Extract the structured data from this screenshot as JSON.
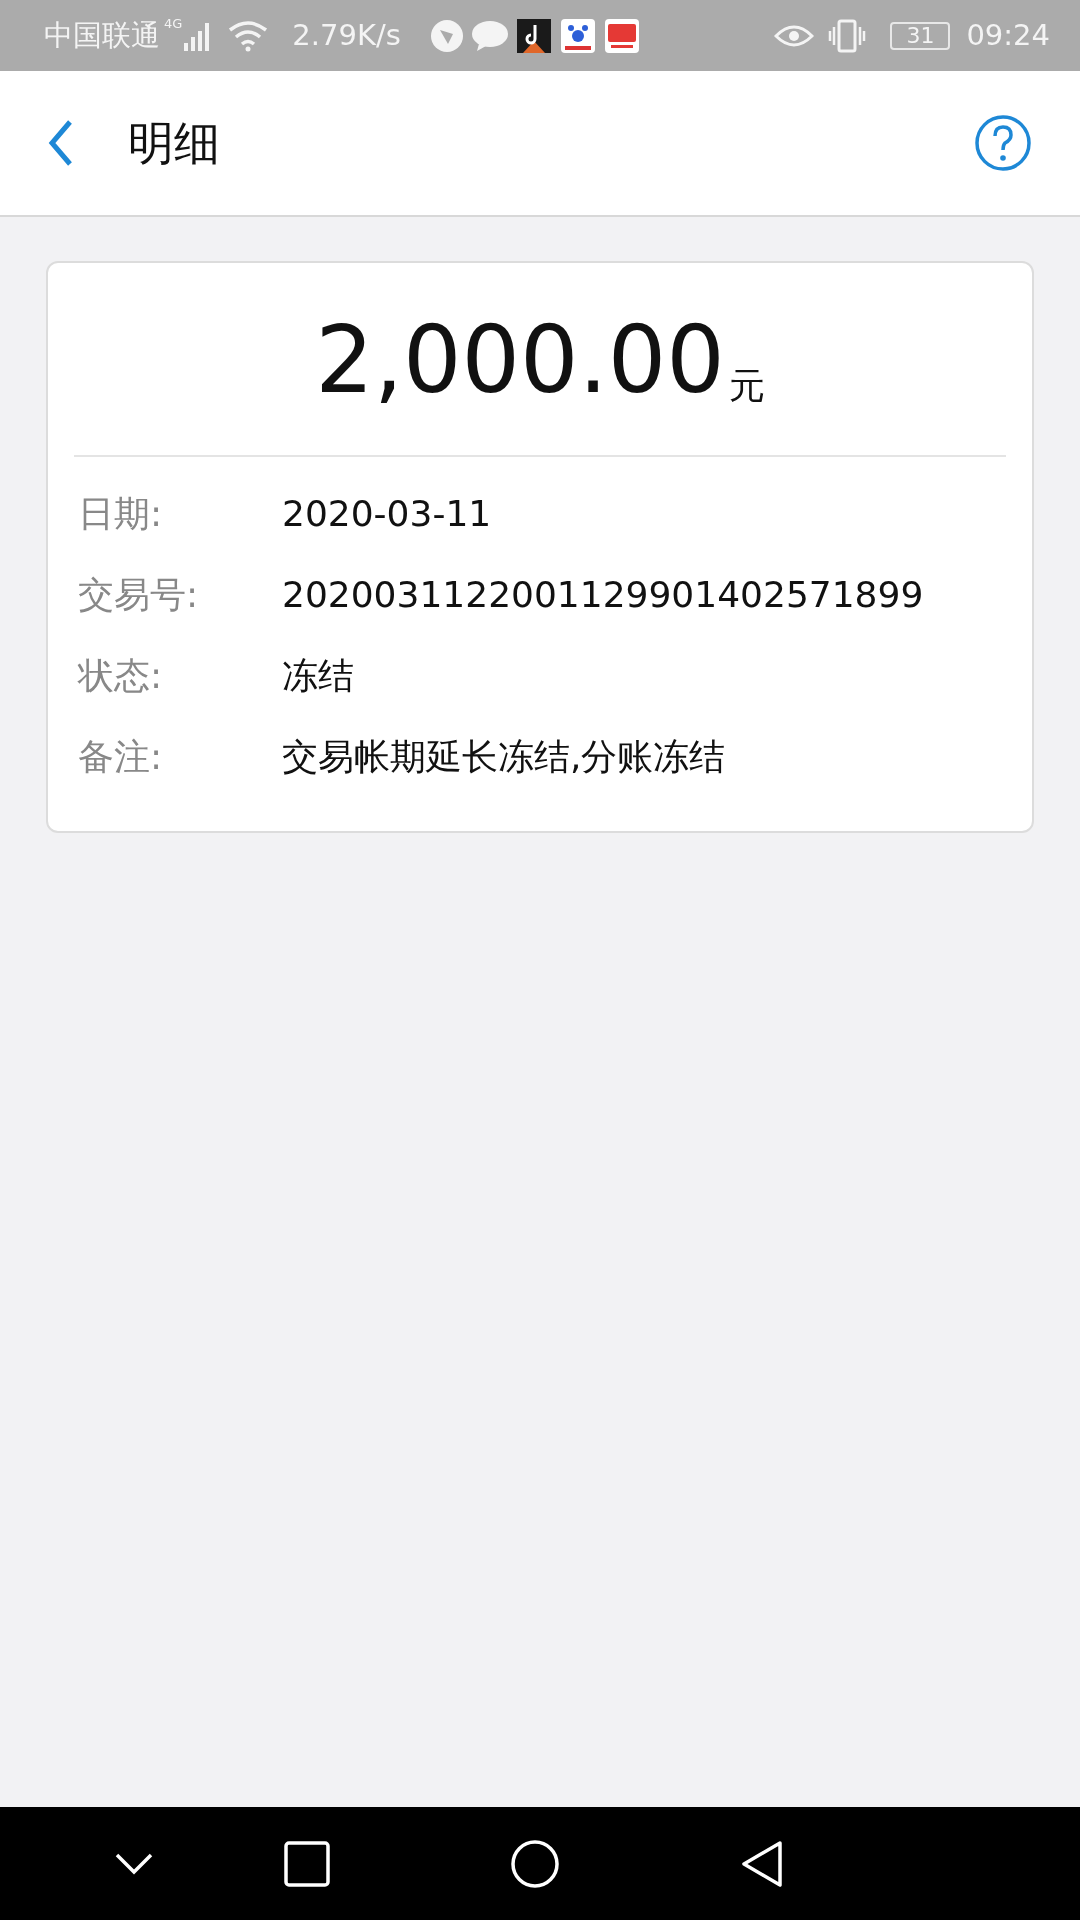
{
  "status_bar": {
    "carrier": "中国联通",
    "network": "4G",
    "speed": "2.79K/s",
    "battery": "31",
    "time": "09:24"
  },
  "header": {
    "title": "明细"
  },
  "detail": {
    "amount": "2,000.00",
    "currency": "元",
    "rows": [
      {
        "label": "日期:",
        "value": "2020-03-11"
      },
      {
        "label": "交易号:",
        "value": "2020031122001129901402571899"
      },
      {
        "label": "状态:",
        "value": "冻结"
      },
      {
        "label": "备注:",
        "value": "交易帐期延长冻结,分账冻结"
      }
    ]
  }
}
